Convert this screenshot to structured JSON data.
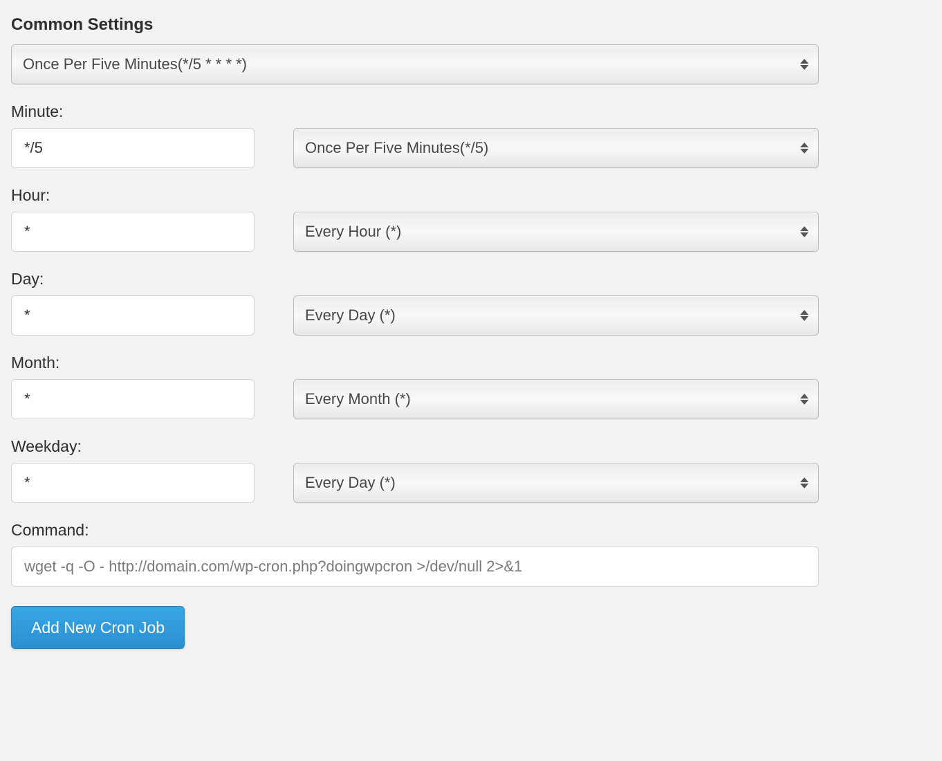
{
  "common_settings": {
    "title": "Common Settings",
    "selected": "Once Per Five Minutes(*/5 * * * *)"
  },
  "minute": {
    "label": "Minute:",
    "value": "*/5",
    "selected": "Once Per Five Minutes(*/5)"
  },
  "hour": {
    "label": "Hour:",
    "value": "*",
    "selected": "Every Hour (*)"
  },
  "day": {
    "label": "Day:",
    "value": "*",
    "selected": "Every Day (*)"
  },
  "month": {
    "label": "Month:",
    "value": "*",
    "selected": "Every Month (*)"
  },
  "weekday": {
    "label": "Weekday:",
    "value": "*",
    "selected": "Every Day (*)"
  },
  "command": {
    "label": "Command:",
    "value": "wget -q -O - http://domain.com/wp-cron.php?doingwpcron >/dev/null 2>&1"
  },
  "submit": {
    "label": "Add New Cron Job"
  }
}
